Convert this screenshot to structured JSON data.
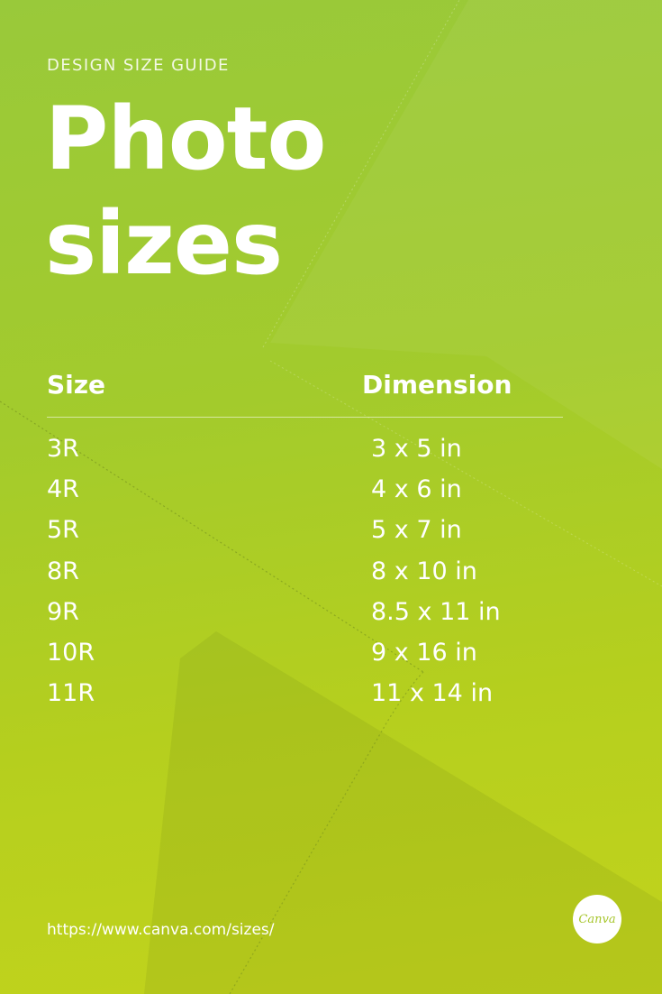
{
  "eyebrow": "DESIGN SIZE GUIDE",
  "headline": {
    "line1": "Photo",
    "line2": "sizes"
  },
  "table": {
    "headers": {
      "size": "Size",
      "dimension": "Dimension"
    },
    "rows": [
      {
        "size": "3R",
        "dimension": "3 x 5 in"
      },
      {
        "size": "4R",
        "dimension": "4 x 6 in"
      },
      {
        "size": "5R",
        "dimension": "5 x 7 in"
      },
      {
        "size": "8R",
        "dimension": "8 x 10 in"
      },
      {
        "size": "9R",
        "dimension": "8.5 x 11 in"
      },
      {
        "size": "10R",
        "dimension": "9 x 16 in"
      },
      {
        "size": "11R",
        "dimension": "11 x 14 in"
      }
    ]
  },
  "footer": {
    "url": "https://www.canva.com/sizes/",
    "logo_text": "Canva"
  },
  "colors": {
    "background_top": "#99c93a",
    "background_bottom": "#c2d31c",
    "text": "#ffffff"
  }
}
